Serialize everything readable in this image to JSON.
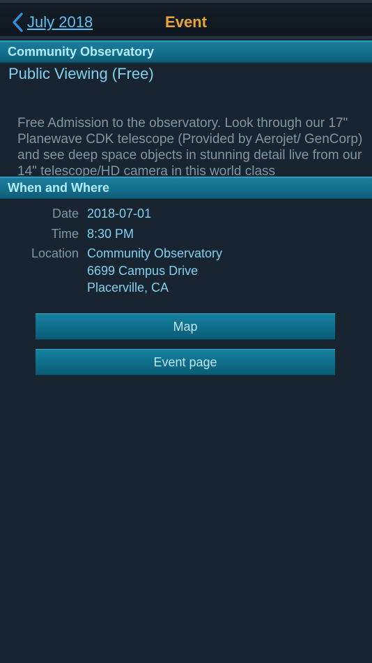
{
  "nav": {
    "back_label": "July 2018",
    "title": "Event"
  },
  "sections": {
    "observatory_header": "Community Observatory",
    "when_where_header": "When and Where"
  },
  "event": {
    "title": "Public Viewing (Free)",
    "description": "Free Admission to the observatory. Look through our 17\" Planewave CDK telescope (Provided by Aerojet/ GenCorp) and see deep space objects in stunning detail live from our 14\" telescope/HD camera in this world class"
  },
  "details": {
    "date_label": "Date",
    "date_value": "2018-07-01",
    "time_label": "Time",
    "time_value": "8:30 PM",
    "location_label": "Location",
    "location_line1": "Community Observatory",
    "location_line2": "6699 Campus Drive",
    "location_line3": "Placerville, CA"
  },
  "buttons": {
    "map": "Map",
    "event_page": "Event page"
  },
  "colors": {
    "background": "#182430",
    "accent_title": "#eaa536",
    "link": "#5ec0f0",
    "section_header": "#136f8c"
  },
  "icons": {
    "back": "chevron-left-icon"
  }
}
